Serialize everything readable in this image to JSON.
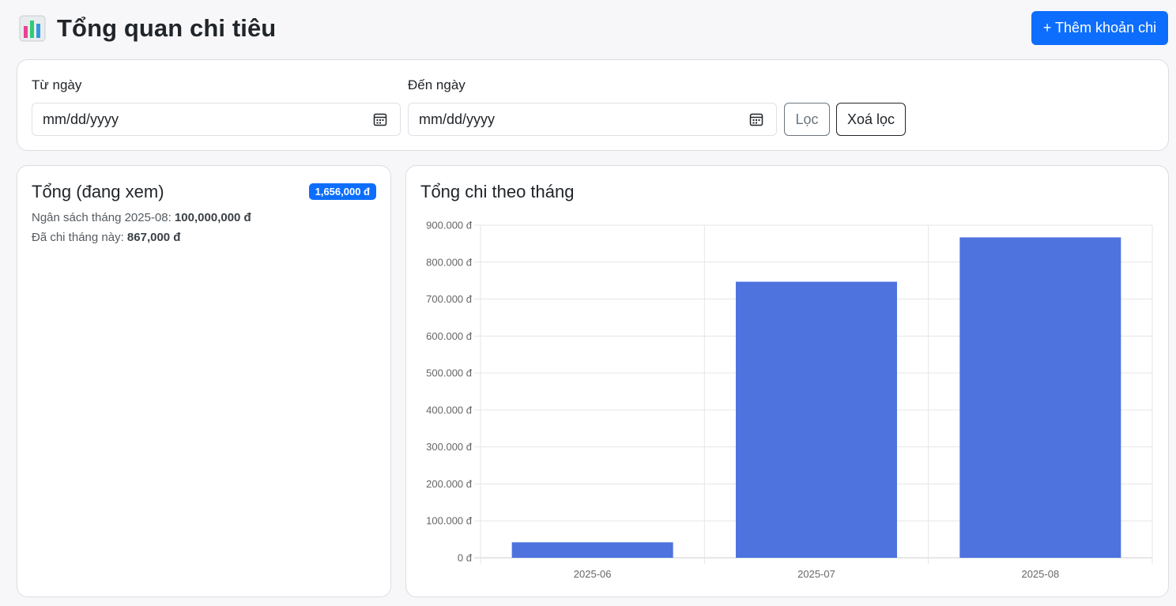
{
  "header": {
    "title": "Tổng quan chi tiêu",
    "add_button": "+ Thêm khoản chi"
  },
  "filter": {
    "from_label": "Từ ngày",
    "from_value": "mm/dd/yyyy",
    "to_label": "Đến ngày",
    "to_value": "mm/dd/yyyy",
    "filter_button": "Lọc",
    "clear_button": "Xoá lọc"
  },
  "summary": {
    "title": "Tổng (đang xem)",
    "total_badge": "1,656,000 đ",
    "budget_label": "Ngân sách tháng 2025-08: ",
    "budget_value": "100,000,000 đ",
    "spent_label": "Đã chi tháng này: ",
    "spent_value": "867,000 đ"
  },
  "chart": {
    "title": "Tổng chi theo tháng"
  },
  "colors": {
    "primary": "#0d6efd",
    "bar": "#4e73df"
  },
  "chart_data": {
    "type": "bar",
    "title": "Tổng chi theo tháng",
    "categories": [
      "2025-06",
      "2025-07",
      "2025-08"
    ],
    "values": [
      42000,
      747000,
      867000
    ],
    "ylim": [
      0,
      900000
    ],
    "y_ticks": [
      "0 đ",
      "100.000 đ",
      "200.000 đ",
      "300.000 đ",
      "400.000 đ",
      "500.000 đ",
      "600.000 đ",
      "700.000 đ",
      "800.000 đ",
      "900.000 đ"
    ],
    "grid": true,
    "legend": "none"
  }
}
